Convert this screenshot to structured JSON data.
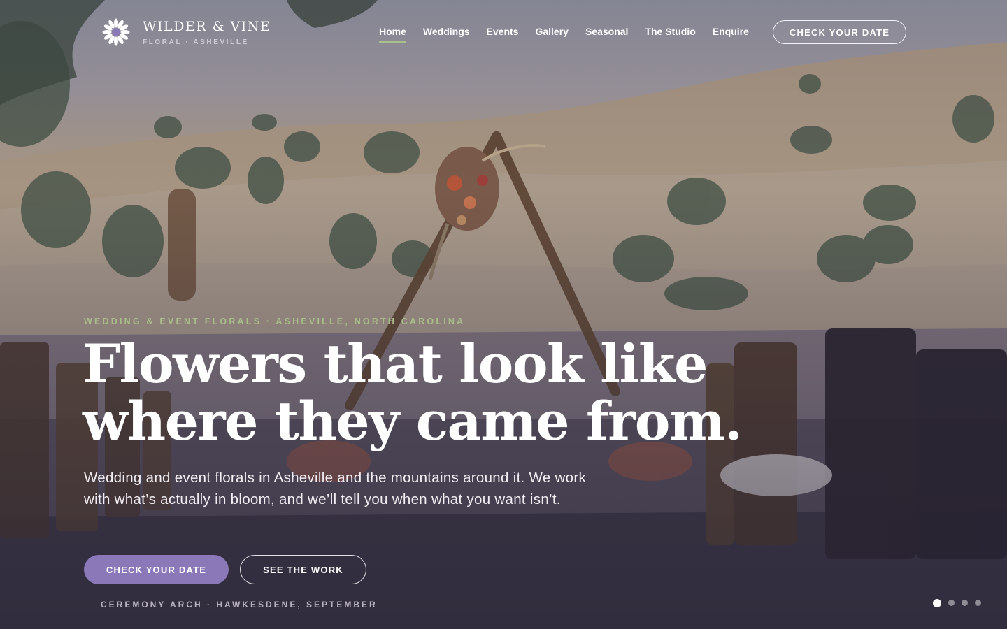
{
  "brand": {
    "name": "WILDER & VINE",
    "tagline": "FLORAL · ASHEVILLE",
    "logo_icon": "daisy-flower-icon"
  },
  "nav": {
    "items": [
      {
        "label": "Home",
        "active": true
      },
      {
        "label": "Weddings",
        "active": false
      },
      {
        "label": "Events",
        "active": false
      },
      {
        "label": "Gallery",
        "active": false
      },
      {
        "label": "Seasonal",
        "active": false
      },
      {
        "label": "The Studio",
        "active": false
      },
      {
        "label": "Enquire",
        "active": false
      }
    ],
    "cta_label": "CHECK YOUR DATE"
  },
  "hero": {
    "eyebrow": "WEDDING & EVENT FLORALS · ASHEVILLE, NORTH CAROLINA",
    "headline_line1": "Flowers that look like",
    "headline_line2": "where they came from.",
    "subcopy": "Wedding and event florals in Asheville and the mountains around it. We work with what’s actually in bloom, and we’ll tell you when what you want isn’t.",
    "primary_cta": "CHECK YOUR DATE",
    "secondary_cta": "SEE THE WORK",
    "caption": "CEREMONY ARCH · HAWKESDENE, SEPTEMBER"
  },
  "slider": {
    "total": 4,
    "active_index": 0
  },
  "colors": {
    "accent_purple": "#8b78b8",
    "eyebrow_green": "#a8bd8a",
    "nav_underline": "#a9c08a"
  }
}
